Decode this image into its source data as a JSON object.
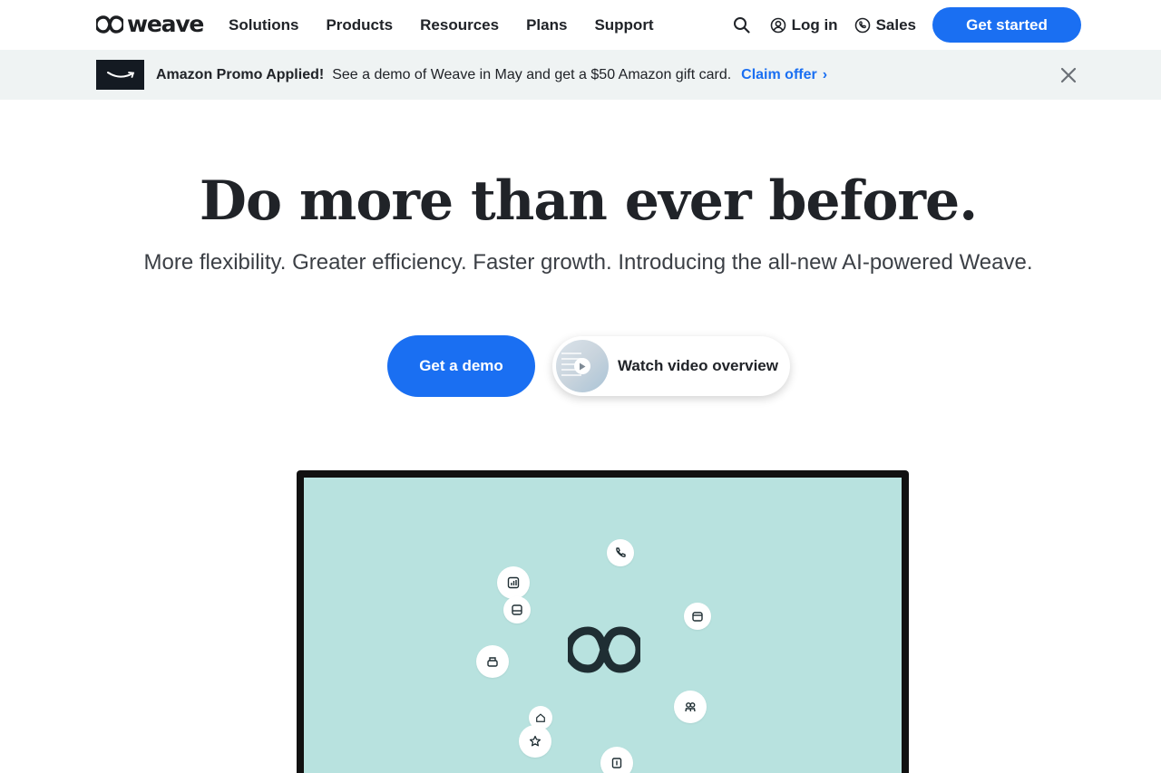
{
  "nav": {
    "logo_text": "weave",
    "links": [
      "Solutions",
      "Products",
      "Resources",
      "Plans",
      "Support"
    ],
    "login": "Log in",
    "sales": "Sales",
    "cta": "Get started"
  },
  "promo": {
    "title": "Amazon Promo Applied!",
    "body": "See a demo of Weave in May and get a $50 Amazon gift card.",
    "link": "Claim offer",
    "chevron": "›"
  },
  "hero": {
    "title": "Do more than ever before.",
    "subtitle": "More flexibility. Greater efficiency. Faster growth. Introducing the all-new AI-powered Weave.",
    "demo_button": "Get a demo",
    "video_button": "Watch video overview"
  },
  "icons": {
    "search": "search-icon",
    "login": "user-circle-icon",
    "sales": "phone-icon",
    "close": "close-icon",
    "play": "play-icon"
  },
  "colors": {
    "accent": "#1a6ff2",
    "promo_bg": "#eff3f3",
    "screen_bg": "#b8e2df",
    "text": "#202328"
  }
}
